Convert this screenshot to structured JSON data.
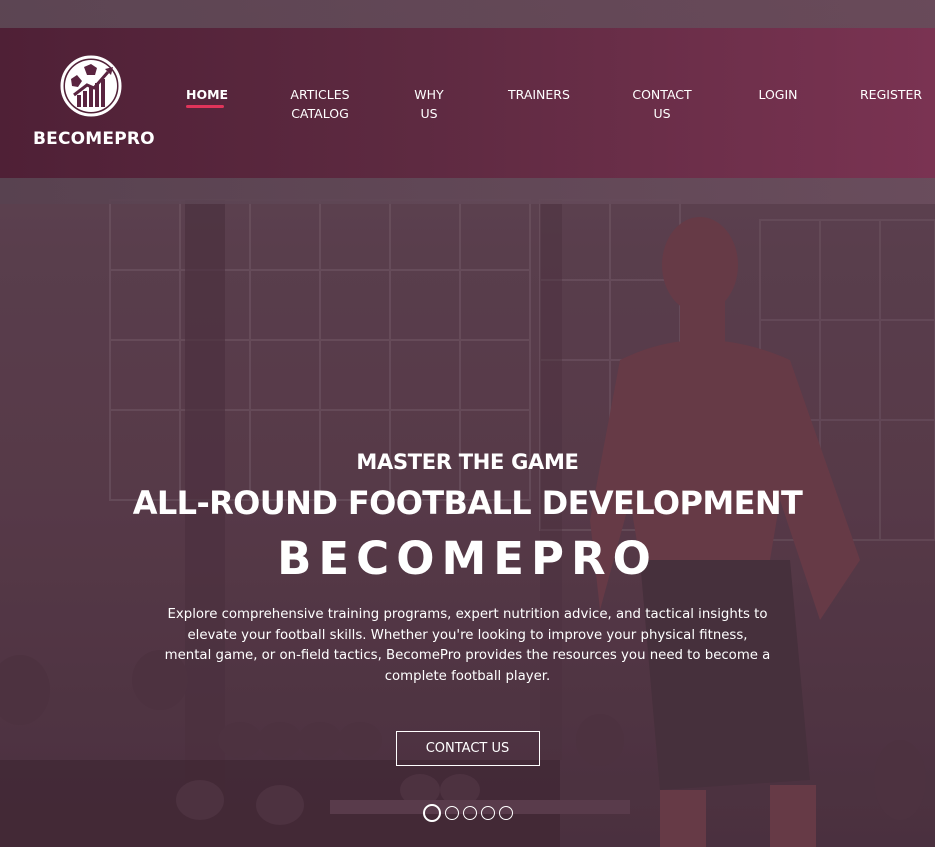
{
  "brand": {
    "name": "BECOMEPRO"
  },
  "nav": {
    "items": [
      {
        "label": "HOME",
        "active": true
      },
      {
        "label": "ARTICLES CATALOG",
        "active": false
      },
      {
        "label": "WHY US",
        "active": false
      },
      {
        "label": "TRAINERS",
        "active": false
      },
      {
        "label": "CONTACT US",
        "active": false
      },
      {
        "label": "LOGIN",
        "active": false
      },
      {
        "label": "REGISTER",
        "active": false
      }
    ]
  },
  "hero": {
    "tagline": "MASTER THE GAME",
    "headline": "ALL-ROUND FOOTBALL DEVELOPMENT",
    "brand_title": "BECOMEPRO",
    "description": "Explore comprehensive training programs, expert nutrition advice, and tactical insights to elevate your football skills. Whether you're looking to improve your physical fitness, mental game, or on-field tactics, BecomePro provides the resources you need to become a complete football player.",
    "cta_label": "CONTACT US"
  },
  "slider": {
    "count": 5,
    "active_index": 0
  },
  "colors": {
    "accent": "#e0345a",
    "header_start": "#4f2036",
    "header_end": "#7a3352"
  },
  "icons": {
    "logo": "football-growth-chart-icon"
  }
}
